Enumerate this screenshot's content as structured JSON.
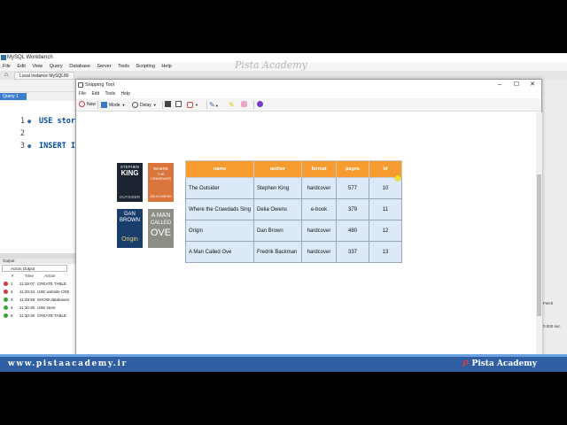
{
  "workbench": {
    "title": "MySQL Workbench",
    "menu": [
      "File",
      "Edit",
      "View",
      "Query",
      "Database",
      "Server",
      "Tools",
      "Scripting",
      "Help"
    ],
    "connection_tab": "Local instance MySQL80",
    "query_tab": "Query 1",
    "code_lines": [
      {
        "num": "1",
        "text": "USE store"
      },
      {
        "num": "2",
        "text": ""
      },
      {
        "num": "3",
        "text": "INSERT I"
      }
    ],
    "output": {
      "header": "Output",
      "selector": "Action Output",
      "col_num": "#",
      "col_time": "Time",
      "col_action": "Action",
      "rows": [
        {
          "n": "1",
          "time": "11:29:07",
          "action": "CREATE TABLE",
          "status": "error"
        },
        {
          "n": "2",
          "time": "11:29:34",
          "action": "USE website CRE",
          "status": "error"
        },
        {
          "n": "3",
          "time": "11:29:59",
          "action": "SHOW databases",
          "status": "ok"
        },
        {
          "n": "4",
          "time": "11:30:30",
          "action": "USE store",
          "status": "ok"
        },
        {
          "n": "5",
          "time": "11:30:30",
          "action": "CREATE TABLE",
          "status": "ok"
        }
      ]
    },
    "right_panel": {
      "fetch": "Fetch",
      "duration": "0.000 sec"
    }
  },
  "snipping_tool": {
    "title": "Snipping Tool",
    "menu": [
      "File",
      "Edit",
      "Tools",
      "Help"
    ],
    "toolbar": {
      "new": "New",
      "mode": "Mode",
      "delay": "Delay"
    },
    "covers": [
      {
        "line1": "STEPHEN",
        "line2": "KING",
        "line3": "OUTSIDER",
        "bg": "#1c2431"
      },
      {
        "line1": "WHERE",
        "line2": "THE CRAWDADS",
        "line3": "DELIA OWENS",
        "bg": "#d9753c"
      },
      {
        "line1": "DAN",
        "line2": "BROWN",
        "line3": "Origin",
        "bg": "#183d6b"
      },
      {
        "line1": "A MAN",
        "line2": "CALLED",
        "line3": "OVE",
        "bg": "#8b8f86"
      }
    ],
    "table": {
      "headers": [
        "name",
        "author",
        "format",
        "pages",
        "id"
      ],
      "rows": [
        [
          "The Outsider",
          "Stephen King",
          "hardcover",
          "577",
          "10"
        ],
        [
          "Where the Crawdads Sing",
          "Delia Owens",
          "e-book",
          "379",
          "11"
        ],
        [
          "Origin",
          "Dan Brown",
          "hardcover",
          "480",
          "12"
        ],
        [
          "A Man Called Ove",
          "Fredrik Backman",
          "hardcover",
          "337",
          "13"
        ]
      ]
    }
  },
  "watermark": "Pista Academy",
  "banner": {
    "url": "www.pistaacademy.ir",
    "brand": "Pista Academy"
  },
  "colors": {
    "header_orange": "#f59b2f",
    "cell_blue": "#dce9f7",
    "banner_blue": "#2f5fa2",
    "error_red": "#d23a3a",
    "ok_green": "#3aa63a"
  }
}
